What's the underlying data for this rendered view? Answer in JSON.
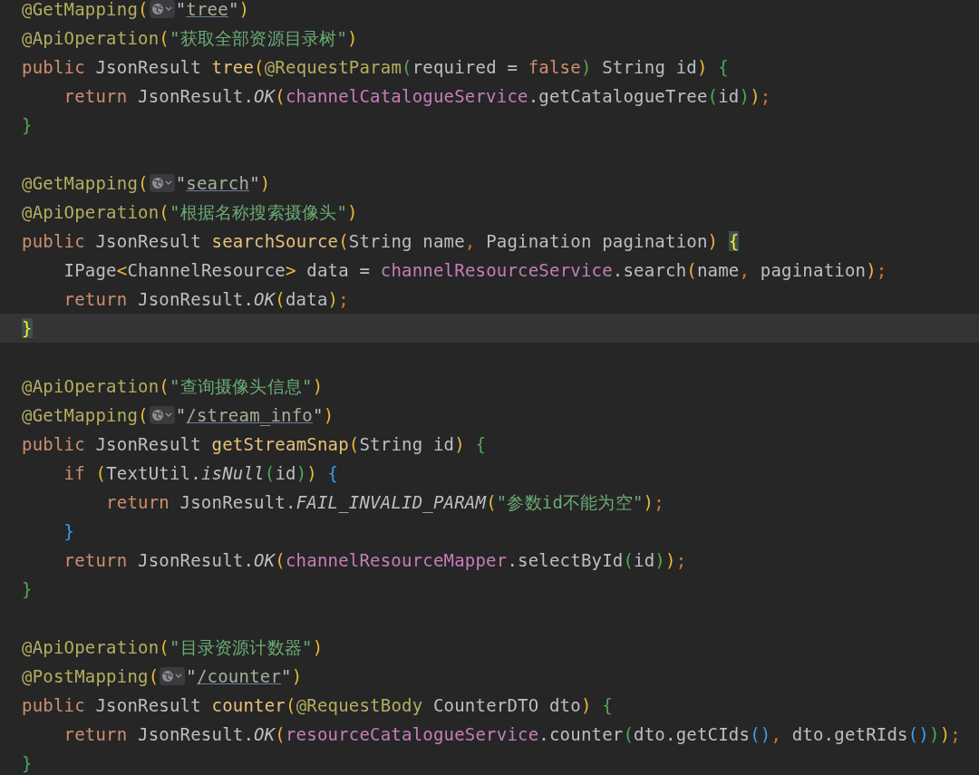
{
  "editor": {
    "lines": [
      {
        "current": false,
        "tokens": [
          {
            "text": "@GetMapping",
            "kind": "annotation"
          },
          {
            "text": "(",
            "kind": "bracket1"
          },
          {
            "kind": "inlay"
          },
          {
            "text": "\"",
            "kind": "plain"
          },
          {
            "text": "tree",
            "kind": "link"
          },
          {
            "text": "\"",
            "kind": "plain"
          },
          {
            "text": ")",
            "kind": "bracket1"
          }
        ]
      },
      {
        "current": false,
        "tokens": [
          {
            "text": "@ApiOperation",
            "kind": "annotation"
          },
          {
            "text": "(",
            "kind": "bracket1"
          },
          {
            "text": "\"获取全部资源目录树\"",
            "kind": "string"
          },
          {
            "text": ")",
            "kind": "bracket1"
          }
        ]
      },
      {
        "current": false,
        "tokens": [
          {
            "text": "public",
            "kind": "keyword"
          },
          {
            "text": " JsonResult ",
            "kind": "plain"
          },
          {
            "text": "tree",
            "kind": "decl"
          },
          {
            "text": "(",
            "kind": "bracket1"
          },
          {
            "text": "@RequestParam",
            "kind": "annotation"
          },
          {
            "text": "(",
            "kind": "bracket2"
          },
          {
            "text": "required = ",
            "kind": "plain"
          },
          {
            "text": "false",
            "kind": "keyword"
          },
          {
            "text": ")",
            "kind": "bracket2"
          },
          {
            "text": " String id",
            "kind": "plain"
          },
          {
            "text": ")",
            "kind": "bracket1"
          },
          {
            "text": " {",
            "kind": "bracket2"
          }
        ]
      },
      {
        "current": false,
        "tokens": [
          {
            "text": "    return",
            "kind": "keyword"
          },
          {
            "text": " JsonResult.",
            "kind": "plain"
          },
          {
            "text": "OK",
            "kind": "static"
          },
          {
            "text": "(",
            "kind": "bracket1"
          },
          {
            "text": "channelCatalogueService",
            "kind": "field"
          },
          {
            "text": ".getCatalogueTree",
            "kind": "plain"
          },
          {
            "text": "(",
            "kind": "bracket2"
          },
          {
            "text": "id",
            "kind": "plain"
          },
          {
            "text": ")",
            "kind": "bracket2"
          },
          {
            "text": ")",
            "kind": "bracket1"
          },
          {
            "text": ";",
            "kind": "punct"
          }
        ]
      },
      {
        "current": false,
        "tokens": [
          {
            "text": "}",
            "kind": "bracket2"
          }
        ]
      },
      {
        "current": false
      },
      {
        "current": false,
        "tokens": [
          {
            "text": "@GetMapping",
            "kind": "annotation"
          },
          {
            "text": "(",
            "kind": "bracket1"
          },
          {
            "kind": "inlay"
          },
          {
            "text": "\"",
            "kind": "plain"
          },
          {
            "text": "search",
            "kind": "link"
          },
          {
            "text": "\"",
            "kind": "plain"
          },
          {
            "text": ")",
            "kind": "bracket1"
          }
        ]
      },
      {
        "current": false,
        "tokens": [
          {
            "text": "@ApiOperation",
            "kind": "annotation"
          },
          {
            "text": "(",
            "kind": "bracket1"
          },
          {
            "text": "\"根据名称搜索摄像头\"",
            "kind": "string"
          },
          {
            "text": ")",
            "kind": "bracket1"
          }
        ]
      },
      {
        "current": false,
        "tokens": [
          {
            "text": "public",
            "kind": "keyword"
          },
          {
            "text": " JsonResult ",
            "kind": "plain"
          },
          {
            "text": "searchSource",
            "kind": "decl"
          },
          {
            "text": "(",
            "kind": "bracket1"
          },
          {
            "text": "String name",
            "kind": "plain"
          },
          {
            "text": ",",
            "kind": "punct"
          },
          {
            "text": " Pagination pagination",
            "kind": "plain"
          },
          {
            "text": ") ",
            "kind": "bracket1"
          },
          {
            "text": "{",
            "kind": "brace_match"
          }
        ]
      },
      {
        "current": false,
        "tokens": [
          {
            "text": "    IPage",
            "kind": "plain"
          },
          {
            "text": "<",
            "kind": "bracket1"
          },
          {
            "text": "ChannelResource",
            "kind": "plain"
          },
          {
            "text": ">",
            "kind": "bracket1"
          },
          {
            "text": " data = ",
            "kind": "plain"
          },
          {
            "text": "channelResourceService",
            "kind": "field"
          },
          {
            "text": ".search",
            "kind": "plain"
          },
          {
            "text": "(",
            "kind": "bracket1"
          },
          {
            "text": "name",
            "kind": "plain"
          },
          {
            "text": ",",
            "kind": "punct"
          },
          {
            "text": " pagination",
            "kind": "plain"
          },
          {
            "text": ")",
            "kind": "bracket1"
          },
          {
            "text": ";",
            "kind": "punct"
          }
        ]
      },
      {
        "current": false,
        "tokens": [
          {
            "text": "    return",
            "kind": "keyword"
          },
          {
            "text": " JsonResult.",
            "kind": "plain"
          },
          {
            "text": "OK",
            "kind": "static"
          },
          {
            "text": "(",
            "kind": "bracket1"
          },
          {
            "text": "data",
            "kind": "plain"
          },
          {
            "text": ")",
            "kind": "bracket1"
          },
          {
            "text": ";",
            "kind": "punct"
          }
        ]
      },
      {
        "current": true,
        "tokens": [
          {
            "text": "}",
            "kind": "brace_match"
          }
        ]
      },
      {
        "current": false
      },
      {
        "current": false,
        "tokens": [
          {
            "text": "@ApiOperation",
            "kind": "annotation"
          },
          {
            "text": "(",
            "kind": "bracket1"
          },
          {
            "text": "\"查询摄像头信息\"",
            "kind": "string"
          },
          {
            "text": ")",
            "kind": "bracket1"
          }
        ]
      },
      {
        "current": false,
        "tokens": [
          {
            "text": "@GetMapping",
            "kind": "annotation"
          },
          {
            "text": "(",
            "kind": "bracket1"
          },
          {
            "kind": "inlay"
          },
          {
            "text": "\"",
            "kind": "plain"
          },
          {
            "text": "/stream_info",
            "kind": "link"
          },
          {
            "text": "\"",
            "kind": "plain"
          },
          {
            "text": ")",
            "kind": "bracket1"
          }
        ]
      },
      {
        "current": false,
        "tokens": [
          {
            "text": "public",
            "kind": "keyword"
          },
          {
            "text": " JsonResult ",
            "kind": "plain"
          },
          {
            "text": "getStreamSnap",
            "kind": "decl"
          },
          {
            "text": "(",
            "kind": "bracket1"
          },
          {
            "text": "String id",
            "kind": "plain"
          },
          {
            "text": ")",
            "kind": "bracket1"
          },
          {
            "text": " {",
            "kind": "bracket2"
          }
        ]
      },
      {
        "current": false,
        "tokens": [
          {
            "text": "    if ",
            "kind": "keyword"
          },
          {
            "text": "(",
            "kind": "bracket1"
          },
          {
            "text": "TextUtil.",
            "kind": "plain"
          },
          {
            "text": "isNull",
            "kind": "static"
          },
          {
            "text": "(",
            "kind": "bracket2"
          },
          {
            "text": "id",
            "kind": "plain"
          },
          {
            "text": ")",
            "kind": "bracket2"
          },
          {
            "text": ")",
            "kind": "bracket1"
          },
          {
            "text": " {",
            "kind": "bracket3"
          }
        ]
      },
      {
        "current": false,
        "tokens": [
          {
            "text": "        return",
            "kind": "keyword"
          },
          {
            "text": " JsonResult.",
            "kind": "plain"
          },
          {
            "text": "FAIL_INVALID_PARAM",
            "kind": "static"
          },
          {
            "text": "(",
            "kind": "bracket1"
          },
          {
            "text": "\"参数id不能为空\"",
            "kind": "string"
          },
          {
            "text": ")",
            "kind": "bracket1"
          },
          {
            "text": ";",
            "kind": "punct"
          }
        ]
      },
      {
        "current": false,
        "tokens": [
          {
            "text": "    }",
            "kind": "bracket3"
          }
        ]
      },
      {
        "current": false,
        "tokens": [
          {
            "text": "    return",
            "kind": "keyword"
          },
          {
            "text": " JsonResult.",
            "kind": "plain"
          },
          {
            "text": "OK",
            "kind": "static"
          },
          {
            "text": "(",
            "kind": "bracket1"
          },
          {
            "text": "channelResourceMapper",
            "kind": "field"
          },
          {
            "text": ".selectById",
            "kind": "plain"
          },
          {
            "text": "(",
            "kind": "bracket2"
          },
          {
            "text": "id",
            "kind": "plain"
          },
          {
            "text": ")",
            "kind": "bracket2"
          },
          {
            "text": ")",
            "kind": "bracket1"
          },
          {
            "text": ";",
            "kind": "punct"
          }
        ]
      },
      {
        "current": false,
        "tokens": [
          {
            "text": "}",
            "kind": "bracket2"
          }
        ]
      },
      {
        "current": false
      },
      {
        "current": false,
        "tokens": [
          {
            "text": "@ApiOperation",
            "kind": "annotation"
          },
          {
            "text": "(",
            "kind": "bracket1"
          },
          {
            "text": "\"目录资源计数器\"",
            "kind": "string"
          },
          {
            "text": ")",
            "kind": "bracket1"
          }
        ]
      },
      {
        "current": false,
        "tokens": [
          {
            "text": "@PostMapping",
            "kind": "annotation"
          },
          {
            "text": "(",
            "kind": "bracket1"
          },
          {
            "kind": "inlay"
          },
          {
            "text": "\"",
            "kind": "plain"
          },
          {
            "text": "/counter",
            "kind": "link"
          },
          {
            "text": "\"",
            "kind": "plain"
          },
          {
            "text": ")",
            "kind": "bracket1"
          }
        ]
      },
      {
        "current": false,
        "tokens": [
          {
            "text": "public",
            "kind": "keyword"
          },
          {
            "text": " JsonResult ",
            "kind": "plain"
          },
          {
            "text": "counter",
            "kind": "decl"
          },
          {
            "text": "(",
            "kind": "bracket1"
          },
          {
            "text": "@RequestBody",
            "kind": "annotation"
          },
          {
            "text": " CounterDTO dto",
            "kind": "plain"
          },
          {
            "text": ")",
            "kind": "bracket1"
          },
          {
            "text": " {",
            "kind": "bracket2"
          }
        ]
      },
      {
        "current": false,
        "tokens": [
          {
            "text": "    return",
            "kind": "keyword"
          },
          {
            "text": " JsonResult.",
            "kind": "plain"
          },
          {
            "text": "OK",
            "kind": "static"
          },
          {
            "text": "(",
            "kind": "bracket1"
          },
          {
            "text": "resourceCatalogueService",
            "kind": "field"
          },
          {
            "text": ".counter",
            "kind": "plain"
          },
          {
            "text": "(",
            "kind": "bracket2"
          },
          {
            "text": "dto.getCIds",
            "kind": "plain"
          },
          {
            "text": "(",
            "kind": "bracket3"
          },
          {
            "text": ")",
            "kind": "bracket3"
          },
          {
            "text": ",",
            "kind": "punct"
          },
          {
            "text": " dto.getRIds",
            "kind": "plain"
          },
          {
            "text": "(",
            "kind": "bracket3"
          },
          {
            "text": ")",
            "kind": "bracket3"
          },
          {
            "text": ")",
            "kind": "bracket2"
          },
          {
            "text": ")",
            "kind": "bracket1"
          },
          {
            "text": ";",
            "kind": "punct"
          }
        ]
      },
      {
        "current": false,
        "tokens": [
          {
            "text": "}",
            "kind": "bracket2"
          }
        ]
      }
    ]
  }
}
